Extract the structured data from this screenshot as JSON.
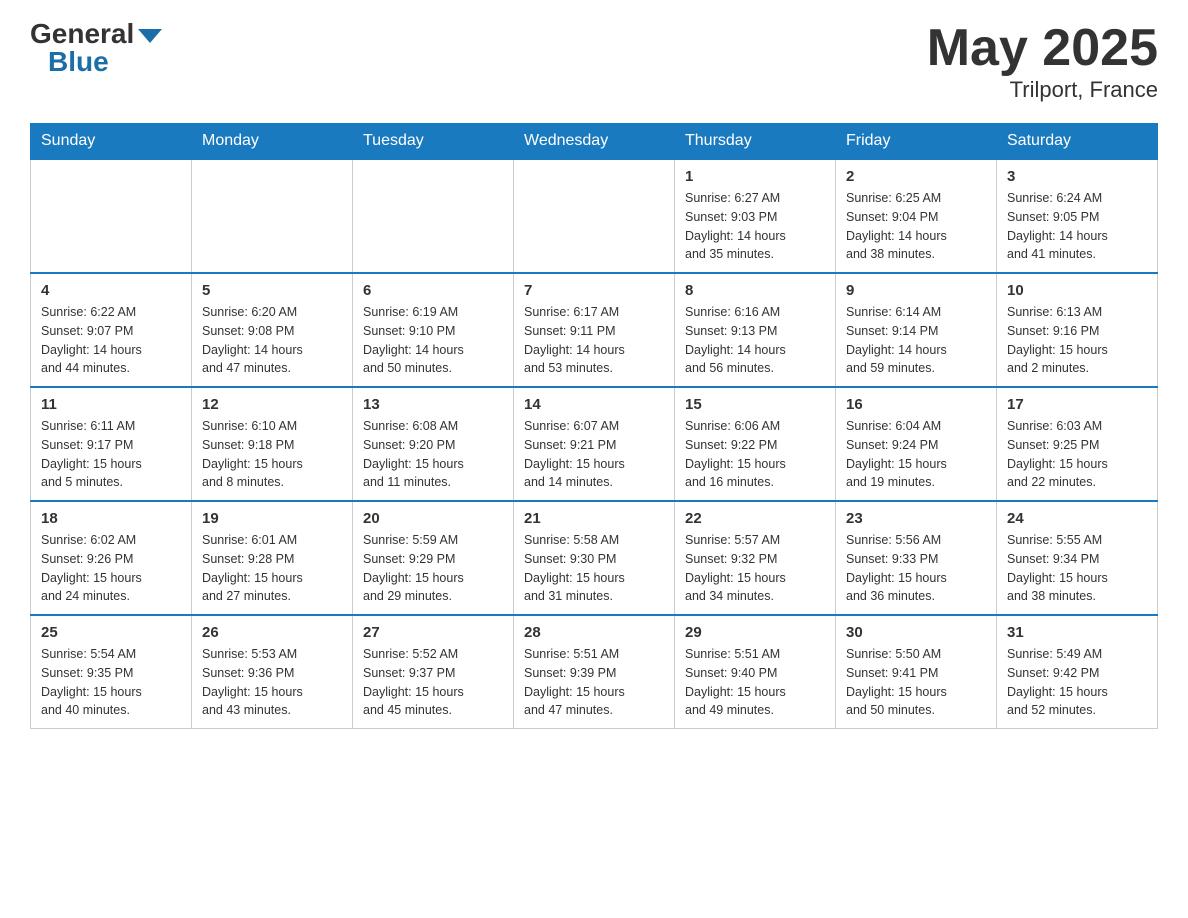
{
  "header": {
    "logo_general": "General",
    "logo_blue": "Blue",
    "month_year": "May 2025",
    "location": "Trilport, France"
  },
  "days_of_week": [
    "Sunday",
    "Monday",
    "Tuesday",
    "Wednesday",
    "Thursday",
    "Friday",
    "Saturday"
  ],
  "weeks": [
    [
      {
        "day": "",
        "info": ""
      },
      {
        "day": "",
        "info": ""
      },
      {
        "day": "",
        "info": ""
      },
      {
        "day": "",
        "info": ""
      },
      {
        "day": "1",
        "info": "Sunrise: 6:27 AM\nSunset: 9:03 PM\nDaylight: 14 hours\nand 35 minutes."
      },
      {
        "day": "2",
        "info": "Sunrise: 6:25 AM\nSunset: 9:04 PM\nDaylight: 14 hours\nand 38 minutes."
      },
      {
        "day": "3",
        "info": "Sunrise: 6:24 AM\nSunset: 9:05 PM\nDaylight: 14 hours\nand 41 minutes."
      }
    ],
    [
      {
        "day": "4",
        "info": "Sunrise: 6:22 AM\nSunset: 9:07 PM\nDaylight: 14 hours\nand 44 minutes."
      },
      {
        "day": "5",
        "info": "Sunrise: 6:20 AM\nSunset: 9:08 PM\nDaylight: 14 hours\nand 47 minutes."
      },
      {
        "day": "6",
        "info": "Sunrise: 6:19 AM\nSunset: 9:10 PM\nDaylight: 14 hours\nand 50 minutes."
      },
      {
        "day": "7",
        "info": "Sunrise: 6:17 AM\nSunset: 9:11 PM\nDaylight: 14 hours\nand 53 minutes."
      },
      {
        "day": "8",
        "info": "Sunrise: 6:16 AM\nSunset: 9:13 PM\nDaylight: 14 hours\nand 56 minutes."
      },
      {
        "day": "9",
        "info": "Sunrise: 6:14 AM\nSunset: 9:14 PM\nDaylight: 14 hours\nand 59 minutes."
      },
      {
        "day": "10",
        "info": "Sunrise: 6:13 AM\nSunset: 9:16 PM\nDaylight: 15 hours\nand 2 minutes."
      }
    ],
    [
      {
        "day": "11",
        "info": "Sunrise: 6:11 AM\nSunset: 9:17 PM\nDaylight: 15 hours\nand 5 minutes."
      },
      {
        "day": "12",
        "info": "Sunrise: 6:10 AM\nSunset: 9:18 PM\nDaylight: 15 hours\nand 8 minutes."
      },
      {
        "day": "13",
        "info": "Sunrise: 6:08 AM\nSunset: 9:20 PM\nDaylight: 15 hours\nand 11 minutes."
      },
      {
        "day": "14",
        "info": "Sunrise: 6:07 AM\nSunset: 9:21 PM\nDaylight: 15 hours\nand 14 minutes."
      },
      {
        "day": "15",
        "info": "Sunrise: 6:06 AM\nSunset: 9:22 PM\nDaylight: 15 hours\nand 16 minutes."
      },
      {
        "day": "16",
        "info": "Sunrise: 6:04 AM\nSunset: 9:24 PM\nDaylight: 15 hours\nand 19 minutes."
      },
      {
        "day": "17",
        "info": "Sunrise: 6:03 AM\nSunset: 9:25 PM\nDaylight: 15 hours\nand 22 minutes."
      }
    ],
    [
      {
        "day": "18",
        "info": "Sunrise: 6:02 AM\nSunset: 9:26 PM\nDaylight: 15 hours\nand 24 minutes."
      },
      {
        "day": "19",
        "info": "Sunrise: 6:01 AM\nSunset: 9:28 PM\nDaylight: 15 hours\nand 27 minutes."
      },
      {
        "day": "20",
        "info": "Sunrise: 5:59 AM\nSunset: 9:29 PM\nDaylight: 15 hours\nand 29 minutes."
      },
      {
        "day": "21",
        "info": "Sunrise: 5:58 AM\nSunset: 9:30 PM\nDaylight: 15 hours\nand 31 minutes."
      },
      {
        "day": "22",
        "info": "Sunrise: 5:57 AM\nSunset: 9:32 PM\nDaylight: 15 hours\nand 34 minutes."
      },
      {
        "day": "23",
        "info": "Sunrise: 5:56 AM\nSunset: 9:33 PM\nDaylight: 15 hours\nand 36 minutes."
      },
      {
        "day": "24",
        "info": "Sunrise: 5:55 AM\nSunset: 9:34 PM\nDaylight: 15 hours\nand 38 minutes."
      }
    ],
    [
      {
        "day": "25",
        "info": "Sunrise: 5:54 AM\nSunset: 9:35 PM\nDaylight: 15 hours\nand 40 minutes."
      },
      {
        "day": "26",
        "info": "Sunrise: 5:53 AM\nSunset: 9:36 PM\nDaylight: 15 hours\nand 43 minutes."
      },
      {
        "day": "27",
        "info": "Sunrise: 5:52 AM\nSunset: 9:37 PM\nDaylight: 15 hours\nand 45 minutes."
      },
      {
        "day": "28",
        "info": "Sunrise: 5:51 AM\nSunset: 9:39 PM\nDaylight: 15 hours\nand 47 minutes."
      },
      {
        "day": "29",
        "info": "Sunrise: 5:51 AM\nSunset: 9:40 PM\nDaylight: 15 hours\nand 49 minutes."
      },
      {
        "day": "30",
        "info": "Sunrise: 5:50 AM\nSunset: 9:41 PM\nDaylight: 15 hours\nand 50 minutes."
      },
      {
        "day": "31",
        "info": "Sunrise: 5:49 AM\nSunset: 9:42 PM\nDaylight: 15 hours\nand 52 minutes."
      }
    ]
  ]
}
